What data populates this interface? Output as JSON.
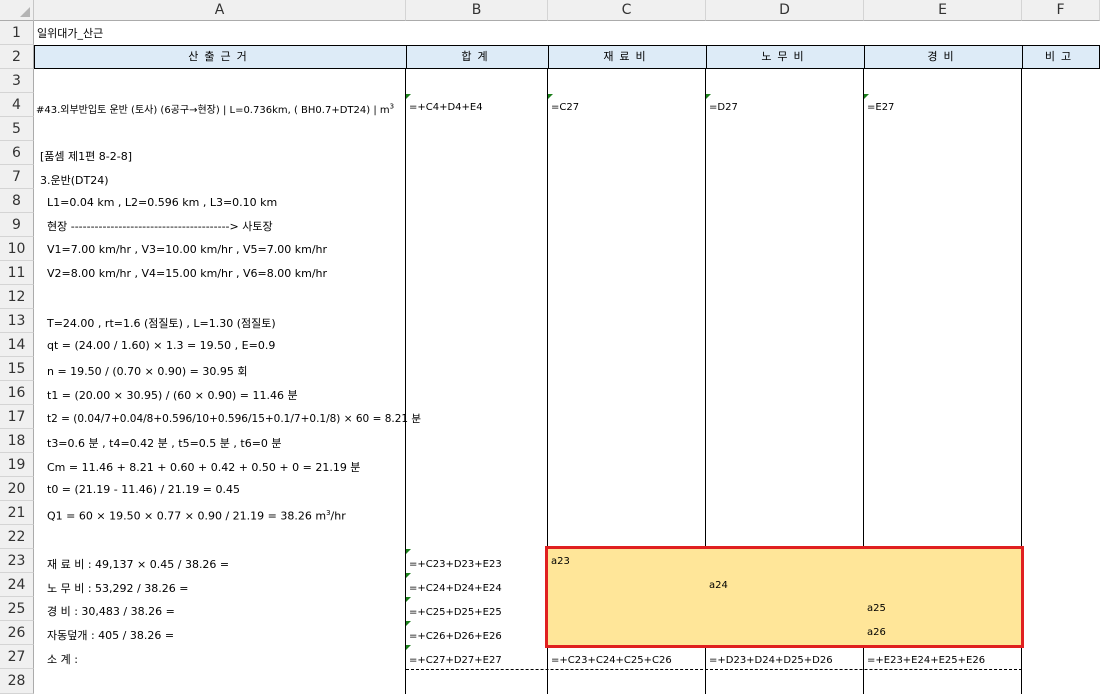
{
  "columns": [
    "A",
    "B",
    "C",
    "D",
    "E",
    "F"
  ],
  "rows": [
    "1",
    "2",
    "3",
    "4",
    "5",
    "6",
    "7",
    "8",
    "9",
    "10",
    "11",
    "12",
    "13",
    "14",
    "15",
    "16",
    "17",
    "18",
    "19",
    "20",
    "21",
    "22",
    "23",
    "24",
    "25",
    "26",
    "27",
    "28"
  ],
  "title": "일위대가_산근",
  "header": {
    "a": "산출근거",
    "b": "합계",
    "c": "재료비",
    "d": "노무비",
    "e": "경비",
    "f": "비고"
  },
  "col_a": {
    "r4": "#43.외부반입토 운반 (토사) (6공구→현장) | L=0.736km, ( BH0.7+DT24) | m",
    "r4_sup": "3",
    "r6": "[품셈 제1편 8-2-8]",
    "r7": "3.운반(DT24)",
    "r8": "L1=0.04 km  ,  L2=0.596 km  ,   L3=0.10 km",
    "r9": "현장 ----------------------------------------> 사토장",
    "r10": "V1=7.00 km/hr  , V3=10.00 km/hr  , V5=7.00 km/hr",
    "r11": "V2=8.00 km/hr  , V4=15.00 km/hr  , V6=8.00 km/hr",
    "r13": "T=24.00 , rt=1.6 (점질토)  , L=1.30 (점질토)",
    "r14": "qt = (24.00 / 1.60) × 1.3 = 19.50 , E=0.9",
    "r15": "n = 19.50 / (0.70 × 0.90) = 30.95 회",
    "r16": "t1 = (20.00 × 30.95) / (60 × 0.90) = 11.46 분",
    "r17": "t2 = (0.04/7+0.04/8+0.596/10+0.596/15+0.1/7+0.1/8) × 60 = 8.21 분",
    "r18": "t3=0.6 분 , t4=0.42 분  , t5=0.5 분  , t6=0 분",
    "r19": "Cm = 11.46 + 8.21 + 0.60 + 0.42 + 0.50 + 0 = 21.19 분",
    "r20": "t0 = (21.19 - 11.46) / 21.19 = 0.45",
    "r21": "Q1 = 60 × 19.50 × 0.77 × 0.90 / 21.19 = 38.26 m",
    "r21_sup": "3",
    "r21_tail": "/hr",
    "r23": "재 료 비 :  49,137 × 0.45 / 38.26 =",
    "r24": "노 무 비 :  53,292 / 38.26 =",
    "r25": "경     비 :  30,483 / 38.26 =",
    "r26": "자동덮개 :  405 / 38.26 =",
    "r27": "소     계 :"
  },
  "col_b": {
    "r4": "=+C4+D4+E4",
    "r23": "=+C23+D23+E23",
    "r24": "=+C24+D24+E24",
    "r25": "=+C25+D25+E25",
    "r26": "=+C26+D26+E26",
    "r27": "=+C27+D27+E27"
  },
  "col_c": {
    "r4": "=C27",
    "r23": "a23",
    "r27": "=+C23+C24+C25+C26"
  },
  "col_d": {
    "r4": "=D27",
    "r24": "a24",
    "r27": "=+D23+D24+D25+D26"
  },
  "col_e": {
    "r4": "=E27",
    "r25": "a25",
    "r26": "a26",
    "r27": "=+E23+E24+E25+E26"
  },
  "colors": {
    "header_fill": "#ddebf7",
    "highlight": "#ffe699",
    "red_box": "#e02020",
    "comment_marker": "#1a7f1a"
  }
}
